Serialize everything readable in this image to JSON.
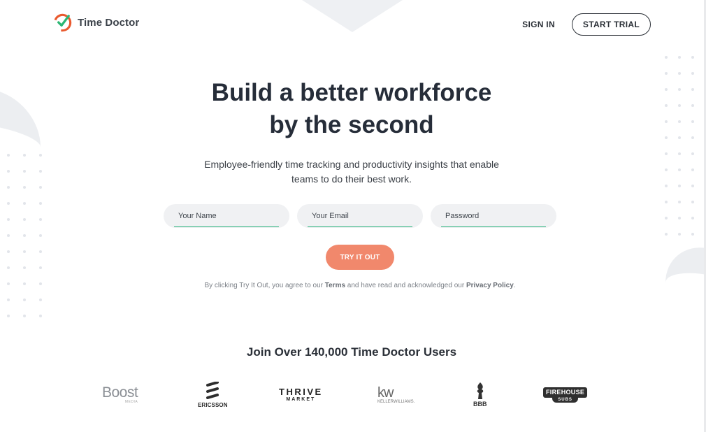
{
  "header": {
    "brand": "Time Doctor",
    "sign_in": "SIGN IN",
    "start_trial": "START TRIAL"
  },
  "hero": {
    "headline_line1": "Build a better workforce",
    "headline_line2": "by the second",
    "subtitle_line1": "Employee-friendly time tracking and productivity insights that enable",
    "subtitle_line2": "teams to do their best work."
  },
  "form": {
    "name_placeholder": "Your Name",
    "email_placeholder": "Your Email",
    "password_placeholder": "Password",
    "submit": "TRY IT OUT"
  },
  "legal": {
    "prefix": "By clicking Try It Out, you agree to our ",
    "terms": "Terms",
    "middle": " and have read and acknowledged our ",
    "privacy": "Privacy Policy",
    "suffix": "."
  },
  "social_proof": {
    "heading": "Join Over 140,000 Time Doctor Users",
    "logos": {
      "boost": {
        "name": "Boost",
        "sub": "MEDIA"
      },
      "ericsson": {
        "name": "ERICSSON"
      },
      "thrive": {
        "name": "THRIVE",
        "sub": "MARKET"
      },
      "keller": {
        "name": "kw",
        "sub": "KELLERWILLIAMS."
      },
      "bbb": {
        "name": "BBB"
      },
      "firehouse": {
        "name": "FIREHOUSE",
        "sub": "SUBS"
      }
    }
  },
  "colors": {
    "accent": "#f1886c",
    "field_underline": "#26b27a",
    "logo_green": "#2bb673",
    "logo_orange": "#e9592e",
    "text_dark": "#262d39"
  },
  "icons": [
    "time-doctor-logo-icon",
    "ericsson-mark-icon",
    "bbb-torch-icon"
  ]
}
